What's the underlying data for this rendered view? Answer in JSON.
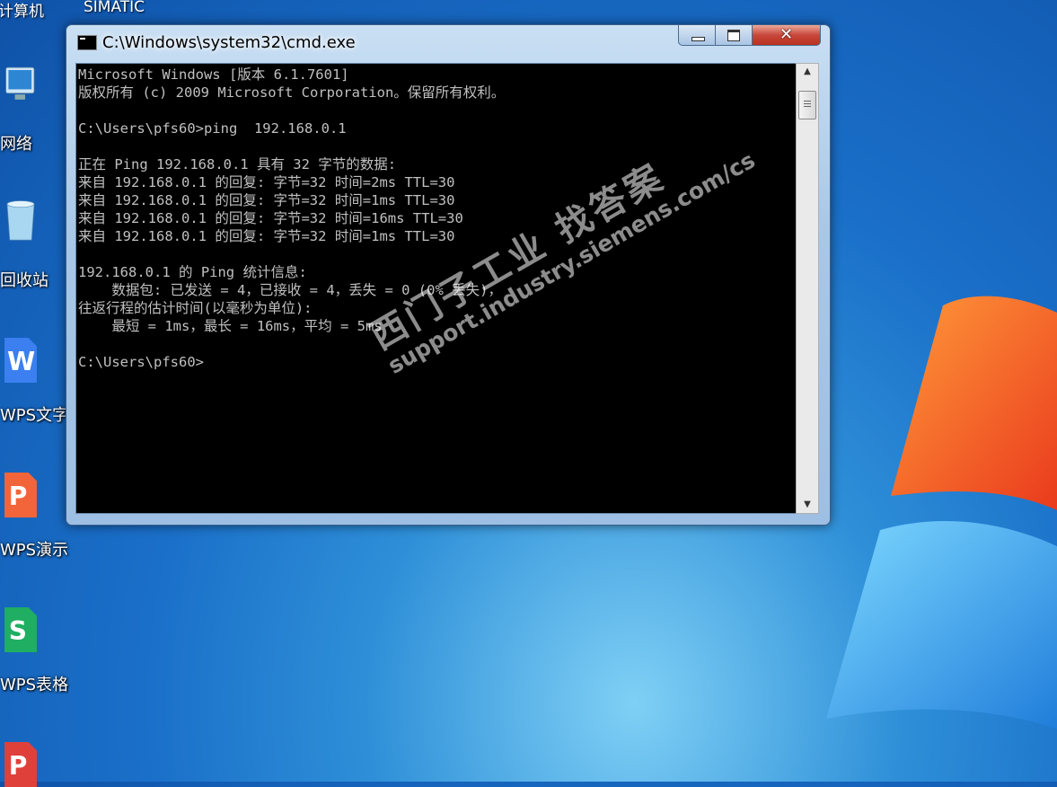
{
  "desktop": {
    "top_labels": [
      "计算机",
      "SIMATIC"
    ],
    "icons": [
      {
        "name": "network",
        "label": "网络"
      },
      {
        "name": "recycle-bin",
        "label": "回收站"
      },
      {
        "name": "wps-writer",
        "label": "WPS文字"
      },
      {
        "name": "wps-presentation",
        "label": "WPS演示"
      },
      {
        "name": "wps-spreadsheet",
        "label": "WPS表格"
      },
      {
        "name": "wps-pdf",
        "label": ""
      }
    ]
  },
  "window": {
    "title": "C:\\Windows\\system32\\cmd.exe",
    "console_lines": [
      "Microsoft Windows [版本 6.1.7601]",
      "版权所有 (c) 2009 Microsoft Corporation。保留所有权利。",
      "",
      "C:\\Users\\pfs60>ping  192.168.0.1",
      "",
      "正在 Ping 192.168.0.1 具有 32 字节的数据:",
      "来自 192.168.0.1 的回复: 字节=32 时间=2ms TTL=30",
      "来自 192.168.0.1 的回复: 字节=32 时间=1ms TTL=30",
      "来自 192.168.0.1 的回复: 字节=32 时间=16ms TTL=30",
      "来自 192.168.0.1 的回复: 字节=32 时间=1ms TTL=30",
      "",
      "192.168.0.1 的 Ping 统计信息:",
      "    数据包: 已发送 = 4，已接收 = 4，丢失 = 0 (0% 丢失)，",
      "往返行程的估计时间(以毫秒为单位):",
      "    最短 = 1ms，最长 = 16ms，平均 = 5ms",
      "",
      "C:\\Users\\pfs60>"
    ]
  },
  "watermark": {
    "line1": "西门子工业  找答案",
    "line2": "support.industry.siemens.com/cs"
  }
}
